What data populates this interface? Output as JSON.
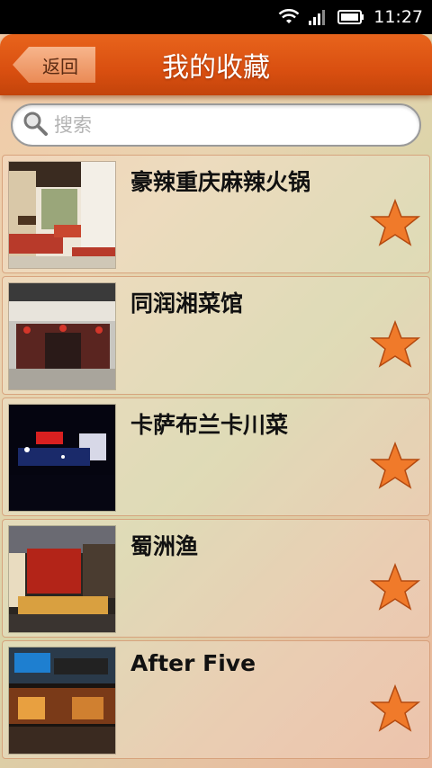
{
  "status_bar": {
    "time": "11:27",
    "icons": [
      "wifi-icon",
      "signal-icon",
      "battery-icon"
    ]
  },
  "header": {
    "back_label": "返回",
    "title": "我的收藏"
  },
  "search": {
    "placeholder": "搜索",
    "value": ""
  },
  "favorites": [
    {
      "name": "豪辣重庆麻辣火锅",
      "favorited": true
    },
    {
      "name": "同润湘菜馆",
      "favorited": true
    },
    {
      "name": "卡萨布兰卡川菜",
      "favorited": true
    },
    {
      "name": "蜀洲渔",
      "favorited": true
    },
    {
      "name": "After Five",
      "favorited": true
    }
  ],
  "colors": {
    "header": "#d94f10",
    "star": "#f07a2a",
    "back_button": "#ea8a55"
  }
}
